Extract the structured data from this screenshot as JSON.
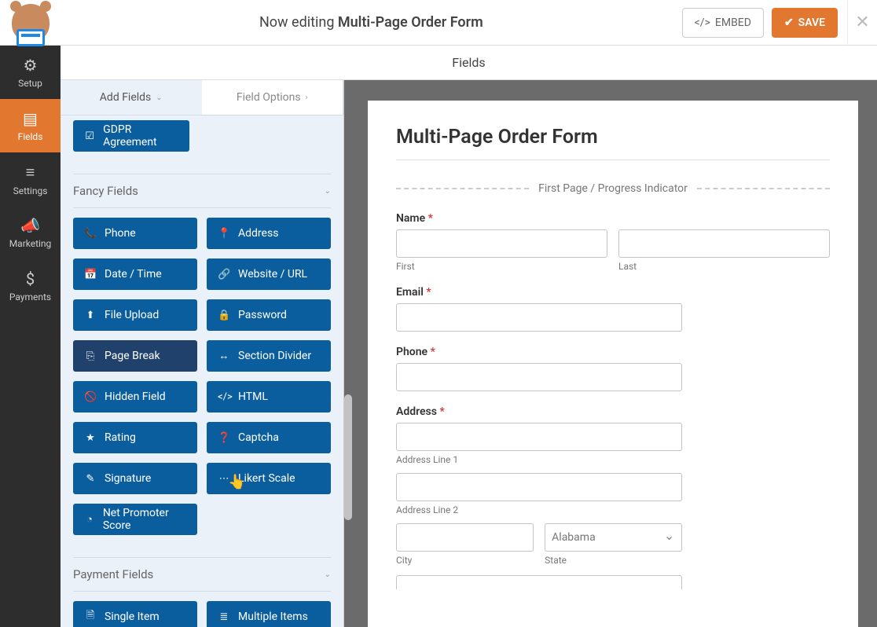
{
  "header": {
    "editing_prefix": "Now editing ",
    "form_name": "Multi-Page Order Form",
    "embed": "EMBED",
    "save": "SAVE"
  },
  "sidenav": [
    {
      "icon": "⚙",
      "label": "Setup"
    },
    {
      "icon": "▤",
      "label": "Fields"
    },
    {
      "icon": "≡",
      "label": "Settings"
    },
    {
      "icon": "📣",
      "label": "Marketing"
    },
    {
      "icon": "$",
      "label": "Payments"
    }
  ],
  "fields_header": "Fields",
  "tabs": {
    "add": "Add Fields",
    "options": "Field Options"
  },
  "panel": {
    "top_chip": {
      "icon": "☑",
      "label": "GDPR Agreement"
    },
    "section1": "Fancy Fields",
    "fancy": [
      [
        {
          "icon": "📞",
          "label": "Phone"
        },
        {
          "icon": "📍",
          "label": "Address"
        }
      ],
      [
        {
          "icon": "📅",
          "label": "Date / Time"
        },
        {
          "icon": "🔗",
          "label": "Website / URL"
        }
      ],
      [
        {
          "icon": "⬆",
          "label": "File Upload"
        },
        {
          "icon": "🔒",
          "label": "Password"
        }
      ],
      [
        {
          "icon": "⎘",
          "label": "Page Break"
        },
        {
          "icon": "↔",
          "label": "Section Divider"
        }
      ],
      [
        {
          "icon": "🚫",
          "label": "Hidden Field"
        },
        {
          "icon": "</>",
          "label": "HTML"
        }
      ],
      [
        {
          "icon": "★",
          "label": "Rating"
        },
        {
          "icon": "❓",
          "label": "Captcha"
        }
      ],
      [
        {
          "icon": "✎",
          "label": "Signature"
        },
        {
          "icon": "⋯",
          "label": "Likert Scale"
        }
      ],
      [
        {
          "icon": "◔",
          "label": "Net Promoter Score"
        }
      ]
    ],
    "section2": "Payment Fields",
    "payment": [
      [
        {
          "icon": "🗎",
          "label": "Single Item"
        },
        {
          "icon": "≣",
          "label": "Multiple Items"
        }
      ]
    ]
  },
  "form": {
    "title": "Multi-Page Order Form",
    "progress": "First Page / Progress Indicator",
    "name_label": "Name",
    "first": "First",
    "last": "Last",
    "email_label": "Email",
    "phone_label": "Phone",
    "address_label": "Address",
    "addr1": "Address Line 1",
    "addr2": "Address Line 2",
    "city": "City",
    "state": "State",
    "state_value": "Alabama"
  }
}
